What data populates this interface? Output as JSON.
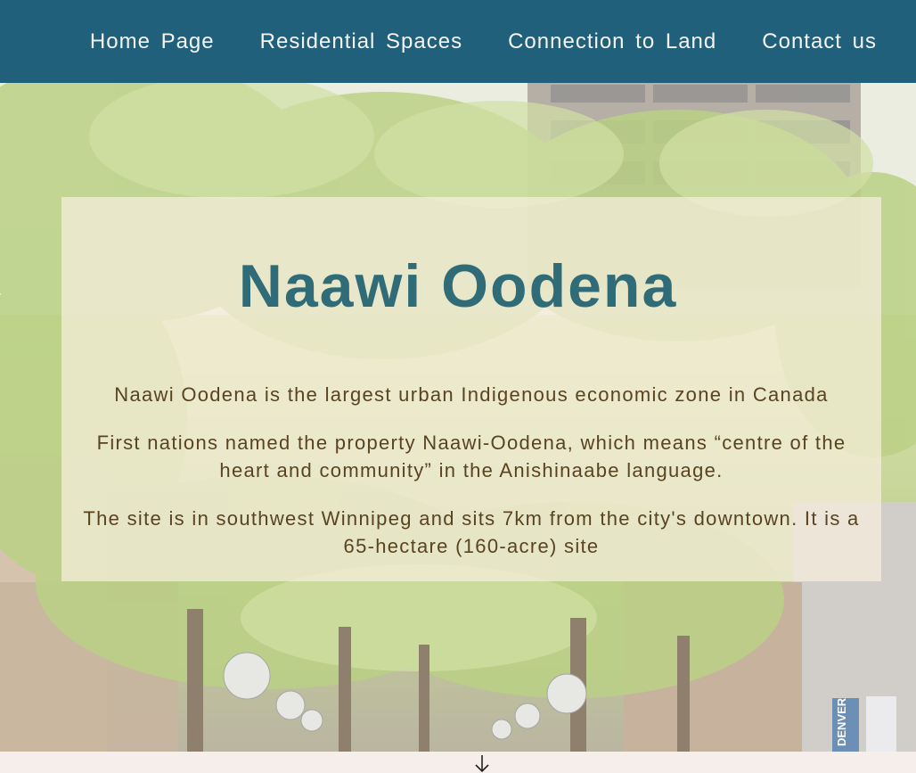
{
  "nav": {
    "items": [
      {
        "label": "Home Page"
      },
      {
        "label": "Residential Spaces"
      },
      {
        "label": "Connection to Land"
      },
      {
        "label": "Contact us"
      }
    ]
  },
  "hero": {
    "title": "Naawi Oodena",
    "paragraphs": [
      "Naawi Oodena is the largest urban Indigenous economic zone in Canada",
      "First nations named the property Naawi-Oodena, which means “centre of the heart and community” in the Anishinaabe language.",
      "The site is in southwest Winnipeg and sits 7km from the city's downtown. It is a 65-hectare (160-acre) site"
    ],
    "banner_text": "DENVER"
  },
  "icons": {
    "scroll": "arrow-down-icon"
  },
  "colors": {
    "nav_bg": "#20607a",
    "title": "#2f6c78",
    "body_text": "#5a4320",
    "page_bg": "#f6eeea"
  }
}
